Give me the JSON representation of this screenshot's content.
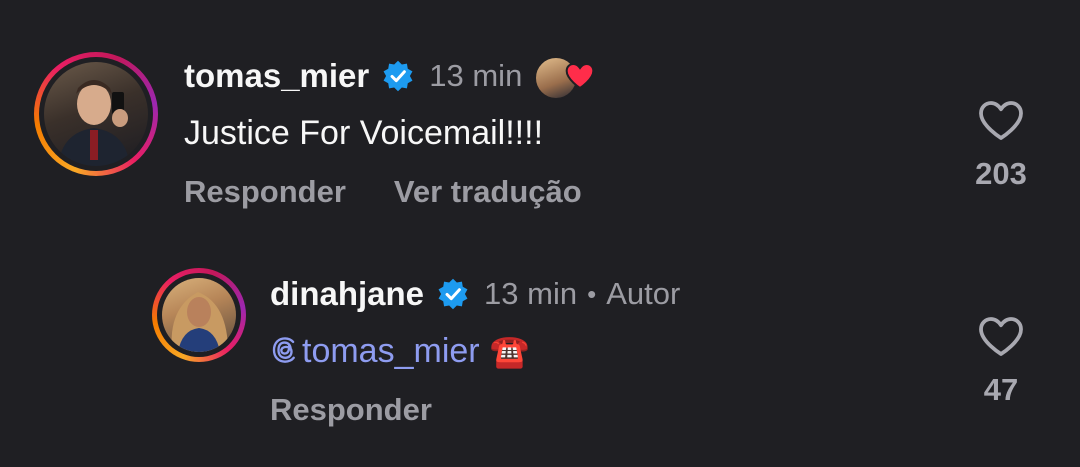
{
  "comments": [
    {
      "username": "tomas_mier",
      "time": "13 min",
      "text": "Justice For Voicemail!!!!",
      "actions": [
        "Responder",
        "Ver tradução"
      ],
      "likes": "203",
      "reaction": "heart"
    },
    {
      "username": "dinahjane",
      "time": "13 min",
      "separator": "•",
      "author_label": "Autor",
      "mention": "tomas_mier",
      "emoji": "☎️",
      "actions": [
        "Responder"
      ],
      "likes": "47"
    }
  ],
  "colors": {
    "background": "#1f1f23",
    "verified": "#1d9bf0",
    "mention": "#8e9cf0",
    "muted": "#9c9ca3",
    "heart_reaction": "#ff2d4a"
  },
  "icons": [
    "verified-badge-icon",
    "heart-outline-icon",
    "heart-filled-icon",
    "threads-at-icon"
  ]
}
